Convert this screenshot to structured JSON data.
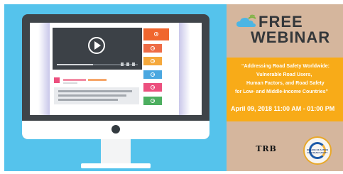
{
  "banner": {
    "title_line1": "FREE",
    "title_line2": "WEBINAR",
    "quote_lines": [
      "“Addressing Road Safety Worldwide:",
      "Vulnerable Road Users,",
      "Human Factors, and Road Safety",
      "for Low- and Middle-Income Countries”"
    ],
    "date_time": "April 09, 2018 11:00 AM - 01:00 PM",
    "logos": {
      "trb": "TRB",
      "decade": "DECADE OF ACTION FOR ROAD SAFETY"
    }
  },
  "illustration": {
    "video_progress": 0.45,
    "icons": [
      "monitor-icon",
      "play-icon",
      "video-icon"
    ],
    "sidebar_tile_colors": [
      "#ee6b45",
      "#f5a83b",
      "#4aa7e0",
      "#ec4f7e",
      "#4cae5f"
    ],
    "video_thumb_color": "#f0662e"
  },
  "colors": {
    "sky": "#55c3ec",
    "banner_orange": "#f8ab18",
    "panel_tan": "#d5b69d",
    "monitor": "#3f4449"
  }
}
